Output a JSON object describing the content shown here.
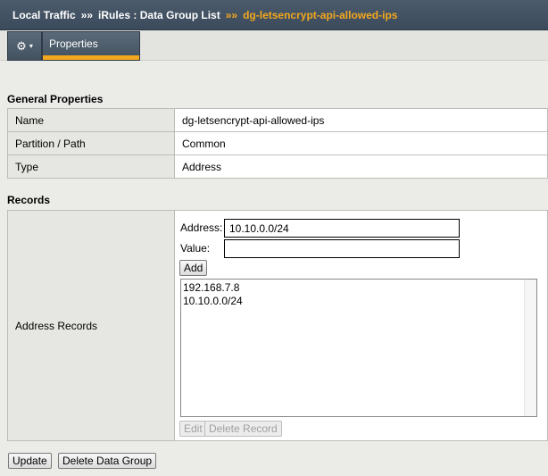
{
  "breadcrumb": {
    "level1": "Local Traffic",
    "level2": "iRules : Data Group List",
    "current": "dg-letsencrypt-api-allowed-ips",
    "separator": "»»"
  },
  "toolbar": {
    "gear_icon": "⚙",
    "caret": "▾",
    "active_tab": "Properties"
  },
  "general": {
    "title": "General Properties",
    "rows": [
      {
        "label": "Name",
        "value": "dg-letsencrypt-api-allowed-ips"
      },
      {
        "label": "Partition / Path",
        "value": "Common"
      },
      {
        "label": "Type",
        "value": "Address"
      }
    ]
  },
  "records": {
    "title": "Records",
    "label": "Address Records",
    "address_label": "Address:",
    "address_value": "10.10.0.0/24",
    "value_label": "Value:",
    "value_value": "",
    "add_button": "Add",
    "items": [
      "192.168.7.8",
      "10.10.0.0/24"
    ],
    "edit_button": "Edit",
    "delete_record_button": "Delete Record"
  },
  "actions": {
    "update_button": "Update",
    "delete_group_button": "Delete Data Group"
  },
  "colors": {
    "header_bg": "#44535f",
    "accent": "#f4a81d",
    "page_bg": "#ebebe8"
  }
}
